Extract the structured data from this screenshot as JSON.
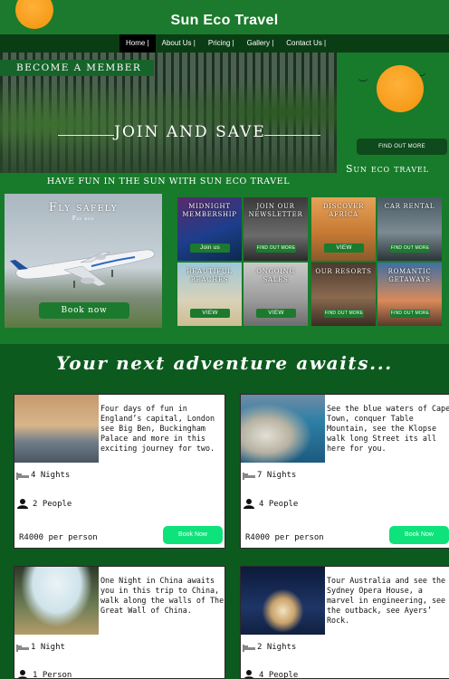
{
  "header": {
    "title": "Sun Eco Travel"
  },
  "nav": {
    "items": [
      "Home |",
      "About Us |",
      "Pricing |",
      "Gallery |",
      "Contact Us |"
    ]
  },
  "hero": {
    "badge": "Become a member",
    "headline": "Join and save",
    "tagline": "Have fun in the sun with sun eco travel",
    "find_out_more": "FIND OUT MORE",
    "right_title": "Sun eco travel"
  },
  "fly": {
    "title": "Fly safely",
    "subtitle": "Fly eco",
    "book_label": "Book now"
  },
  "tiles": [
    {
      "title": "Midnight Membership",
      "button": "Join us"
    },
    {
      "title": "Join our newsletter",
      "button": "FIND OUT MORE"
    },
    {
      "title": "Discover Africa",
      "button": "VIEW"
    },
    {
      "title": "Car Rental",
      "button": "FIND OUT MORE"
    },
    {
      "title": "Beautiful beaches",
      "button": "VIEW"
    },
    {
      "title": "Ongoing sales",
      "button": "VIEW"
    },
    {
      "title": "Our resorts",
      "button": "FIND OUT MORE"
    },
    {
      "title": "Romantic getaways",
      "button": "FIND OUT MORE"
    }
  ],
  "adventure": {
    "title": "Your next adventure awaits..."
  },
  "cards": [
    {
      "desc": "Four days of fun in England’s capital, London see Big Ben, Buckingham Palace and more in this exciting journey for two.",
      "nights": "4 Nights",
      "people": "2 People",
      "price": "R4000 per person",
      "book": "Book Now"
    },
    {
      "desc": "See the blue waters of Cape Town, conquer Table Mountain, see the Klopse walk long Street its all here for you.",
      "nights": "7 Nights",
      "people": "4 People",
      "price": "R4000 per person",
      "book": "Book Now"
    },
    {
      "desc": "One Night in China awaits you in this trip to China, walk along the walls of The Great Wall of China.",
      "nights": "1 Night",
      "people": "1 Person",
      "price": "",
      "book": ""
    },
    {
      "desc": "Tour Australia and see the Sydney Opera House, a marvel in engineering, see the outback, see Ayers’ Rock.",
      "nights": "2 Nights",
      "people": "4 People",
      "price": "",
      "book": ""
    }
  ],
  "icons": {
    "nights": "bed-icon",
    "people": "person-icon",
    "logo": "sun-icon"
  },
  "colors": {
    "brand_green": "#1b7a2d",
    "dark_green": "#0c5a1e",
    "book_button": "#0ee27a",
    "sun_orange": "#f7a21b"
  }
}
